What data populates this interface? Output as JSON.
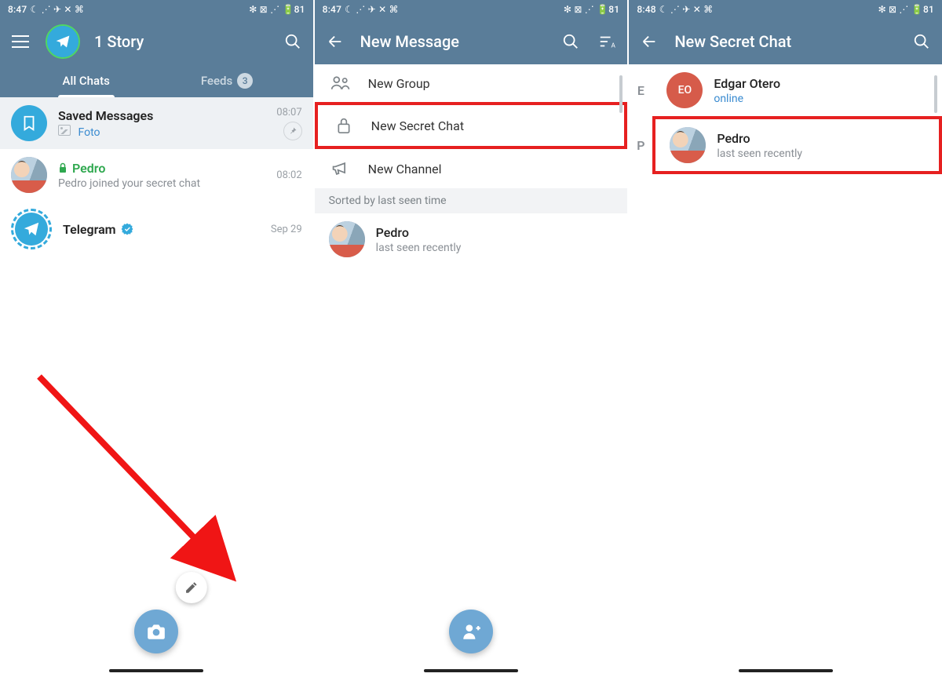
{
  "statusbar": {
    "time1": "8:47",
    "time2": "8:47",
    "time3": "8:48",
    "left_icons": "☾ ⋰ ✈ ✕ ⌘",
    "right_icons": "✻ ⊠ ⋰ 🔋81"
  },
  "screen1": {
    "title": "1 Story",
    "tabs": {
      "all": "All Chats",
      "feeds": "Feeds",
      "feeds_badge": "3"
    },
    "chats": {
      "saved": {
        "name": "Saved Messages",
        "sub": "Foto",
        "time": "08:07"
      },
      "pedro": {
        "name": "Pedro",
        "sub": "Pedro joined your secret chat",
        "time": "08:02"
      },
      "telegram": {
        "name": "Telegram",
        "time": "Sep 29"
      }
    }
  },
  "screen2": {
    "title": "New Message",
    "menu": {
      "new_group": "New Group",
      "new_secret": "New Secret Chat",
      "new_channel": "New Channel"
    },
    "section": "Sorted by last seen time",
    "contact": {
      "name": "Pedro",
      "status": "last seen recently"
    }
  },
  "screen3": {
    "title": "New Secret Chat",
    "E": "E",
    "P": "P",
    "contacts": {
      "edgar": {
        "name": "Edgar Otero",
        "initials": "EO",
        "status": "online"
      },
      "pedro": {
        "name": "Pedro",
        "status": "last seen recently"
      }
    }
  }
}
